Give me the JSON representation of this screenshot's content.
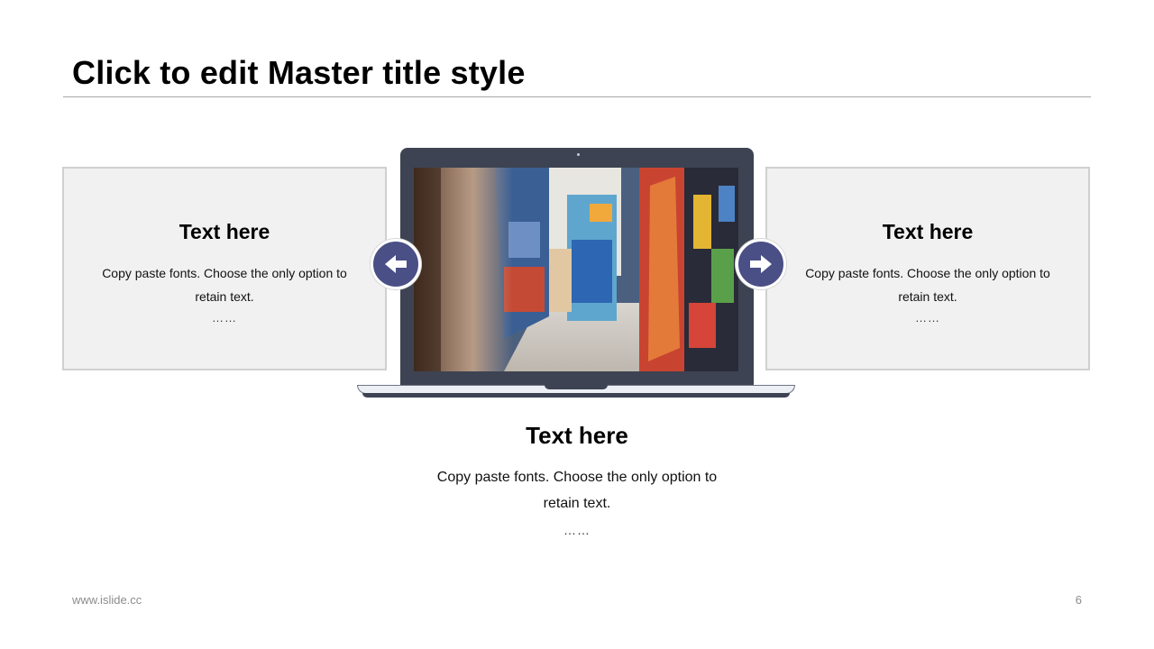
{
  "slide": {
    "title": "Click to edit Master title style",
    "page_number": "6",
    "footer_url": "www.islide.cc"
  },
  "left_card": {
    "heading": "Text here",
    "body": "Copy paste fonts. Choose the only option to retain text.",
    "ellipsis": "……"
  },
  "right_card": {
    "heading": "Text here",
    "body": "Copy paste fonts. Choose the only option to retain text.",
    "ellipsis": "……"
  },
  "center_block": {
    "heading": "Text here",
    "body": "Copy paste fonts. Choose the only option to retain text.",
    "ellipsis": "……"
  },
  "controls": {
    "prev_icon": "arrow-left-icon",
    "next_icon": "arrow-right-icon"
  },
  "colors": {
    "accent": "#4a4f86",
    "laptop_frame": "#3d4352",
    "card_bg": "#f1f1f1",
    "card_border": "#d0d0d0"
  }
}
